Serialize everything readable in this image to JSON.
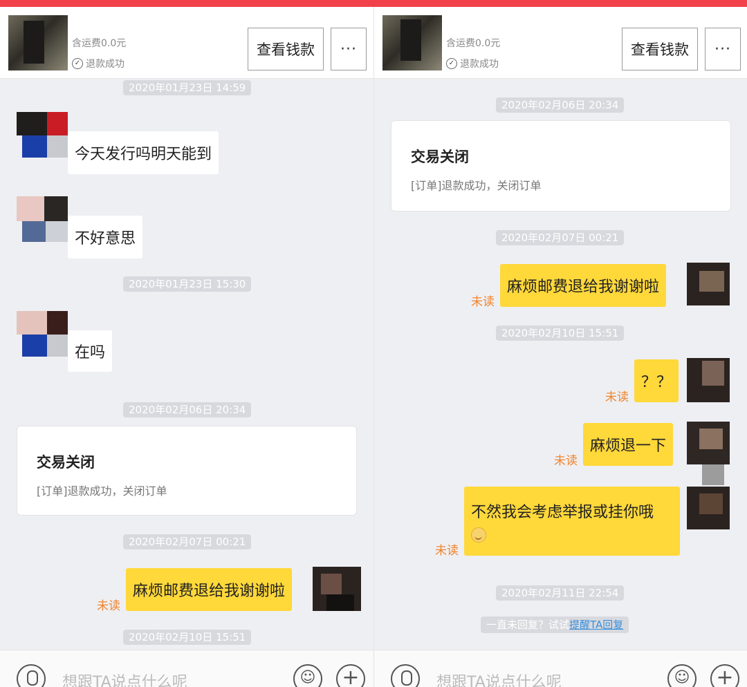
{
  "left": {
    "header": {
      "shipping": "含运费0.0元",
      "refund_status": "退款成功",
      "view_money": "查看钱款",
      "more": "···"
    },
    "timestamps": [
      "2020年01月23日 14:59",
      "2020年01月23日 15:30",
      "2020年02月06日 20:34",
      "2020年02月07日 00:21",
      "2020年02月10日 15:51"
    ],
    "messages": [
      {
        "text": "今天发行吗明天能到"
      },
      {
        "text": "不好意思"
      },
      {
        "text": "在吗"
      },
      {
        "text": "麻烦邮费退给我谢谢啦",
        "status": "未读"
      }
    ],
    "card": {
      "title": "交易关闭",
      "subtitle": "[订单]退款成功，关闭订单"
    },
    "input": {
      "placeholder": "想跟TA说点什么呢"
    }
  },
  "right": {
    "header": {
      "shipping": "含运费0.0元",
      "refund_status": "退款成功",
      "view_money": "查看钱款",
      "more": "···"
    },
    "timestamps": [
      "2020年02月06日 20:34",
      "2020年02月07日 00:21",
      "2020年02月10日 15:51",
      "2020年02月11日 22:54"
    ],
    "card": {
      "title": "交易关闭",
      "subtitle": "[订单]退款成功，关闭订单"
    },
    "messages": [
      {
        "text": "麻烦邮费退给我谢谢啦",
        "status": "未读"
      },
      {
        "text": "？？",
        "status": "未读"
      },
      {
        "text": "麻烦退一下",
        "status": "未读"
      },
      {
        "text": "不然我会考虑举报或挂你哦",
        "status": "未读"
      }
    ],
    "remind": {
      "prefix": "一直未回复？试试",
      "link": "提醒TA回复"
    },
    "input": {
      "placeholder": "想跟TA说点什么呢"
    }
  },
  "colors": {
    "top_strip": "#f2414a",
    "bubble_yellow": "#ffd83a",
    "unread": "#f0842c",
    "link": "#3a8fdc"
  }
}
